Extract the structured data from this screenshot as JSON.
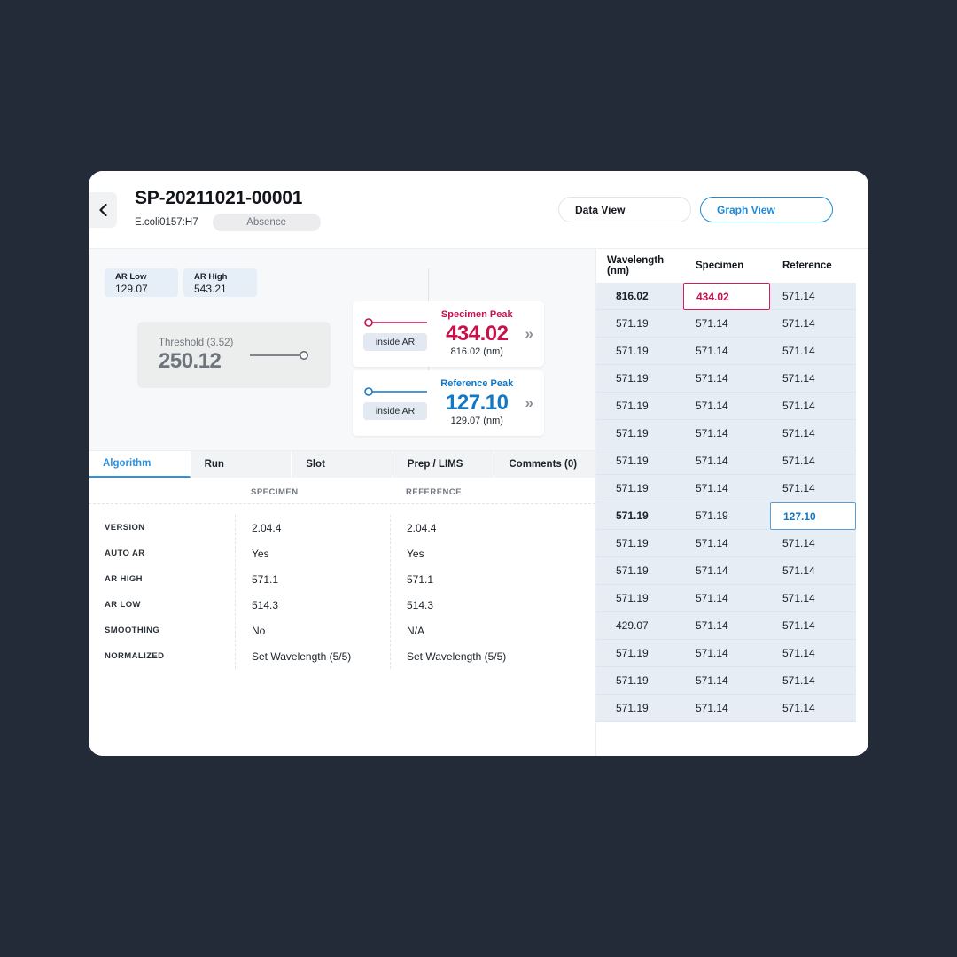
{
  "header": {
    "back_icon": "chevron-left-icon",
    "record_id": "SP-20211021-00001",
    "organism": "E.coli0157:H7",
    "status": "Absence",
    "view_buttons": [
      {
        "label": "Data View",
        "active": false
      },
      {
        "label": "Graph View",
        "active": true
      }
    ]
  },
  "summary": {
    "ar_low": {
      "label": "AR Low",
      "value": "129.07"
    },
    "ar_high": {
      "label": "AR High",
      "value": "543.21"
    },
    "threshold": {
      "label": "Threshold (3.52)",
      "value": "250.12"
    },
    "peaks": [
      {
        "name": "Specimen Peak",
        "value": "434.02",
        "wavelength": "816.02 (nm)",
        "badge": "inside AR",
        "color": "#c8104b"
      },
      {
        "name": "Reference Peak",
        "value": "127.10",
        "wavelength": "129.07 (nm)",
        "badge": "inside AR",
        "color": "#1277c4"
      }
    ]
  },
  "tabs": [
    {
      "label": "Algorithm",
      "active": true
    },
    {
      "label": "Run",
      "active": false
    },
    {
      "label": "Slot",
      "active": false
    },
    {
      "label": "Prep / LIMS",
      "active": false
    },
    {
      "label": "Comments (0)",
      "active": false
    }
  ],
  "algorithm": {
    "columns": [
      "",
      "SPECIMEN",
      "REFERENCE"
    ],
    "rows": [
      {
        "key": "VERSION",
        "specimen": "2.04.4",
        "reference": "2.04.4"
      },
      {
        "key": "AUTO AR",
        "specimen": "Yes",
        "reference": "Yes"
      },
      {
        "key": "AR HIGH",
        "specimen": "571.1",
        "reference": "571.1"
      },
      {
        "key": "AR LOW",
        "specimen": "514.3",
        "reference": "514.3"
      },
      {
        "key": "SMOOTHING",
        "specimen": "No",
        "reference": "N/A"
      },
      {
        "key": "NORMALIZED",
        "specimen": "Set Wavelength (5/5)",
        "reference": "Set Wavelength (5/5)"
      }
    ]
  },
  "data_table": {
    "columns": [
      "Wavelength (nm)",
      "Specimen",
      "Reference"
    ],
    "rows": [
      {
        "wavelength": "816.02",
        "specimen": "434.02",
        "reference": "571.14",
        "wavelength_bold": true,
        "specimen_state": "selected-red",
        "reference_state": "normal"
      },
      {
        "wavelength": "571.19",
        "specimen": "571.14",
        "reference": "571.14",
        "wavelength_bold": false,
        "specimen_state": "normal",
        "reference_state": "normal"
      },
      {
        "wavelength": "571.19",
        "specimen": "571.14",
        "reference": "571.14",
        "wavelength_bold": false,
        "specimen_state": "normal",
        "reference_state": "normal"
      },
      {
        "wavelength": "571.19",
        "specimen": "571.14",
        "reference": "571.14",
        "wavelength_bold": false,
        "specimen_state": "normal",
        "reference_state": "normal"
      },
      {
        "wavelength": "571.19",
        "specimen": "571.14",
        "reference": "571.14",
        "wavelength_bold": false,
        "specimen_state": "normal",
        "reference_state": "normal"
      },
      {
        "wavelength": "571.19",
        "specimen": "571.14",
        "reference": "571.14",
        "wavelength_bold": false,
        "specimen_state": "normal",
        "reference_state": "normal"
      },
      {
        "wavelength": "571.19",
        "specimen": "571.14",
        "reference": "571.14",
        "wavelength_bold": false,
        "specimen_state": "normal",
        "reference_state": "normal"
      },
      {
        "wavelength": "571.19",
        "specimen": "571.14",
        "reference": "571.14",
        "wavelength_bold": false,
        "specimen_state": "normal",
        "reference_state": "normal"
      },
      {
        "wavelength": "571.19",
        "specimen": "571.19",
        "reference": "127.10",
        "wavelength_bold": true,
        "specimen_state": "normal",
        "reference_state": "selected-blue"
      },
      {
        "wavelength": "571.19",
        "specimen": "571.14",
        "reference": "571.14",
        "wavelength_bold": false,
        "specimen_state": "normal",
        "reference_state": "normal"
      },
      {
        "wavelength": "571.19",
        "specimen": "571.14",
        "reference": "571.14",
        "wavelength_bold": false,
        "specimen_state": "normal",
        "reference_state": "normal"
      },
      {
        "wavelength": "571.19",
        "specimen": "571.14",
        "reference": "571.14",
        "wavelength_bold": false,
        "specimen_state": "normal",
        "reference_state": "normal"
      },
      {
        "wavelength": "429.07",
        "specimen": "571.14",
        "reference": "571.14",
        "wavelength_bold": false,
        "specimen_state": "normal",
        "reference_state": "normal"
      },
      {
        "wavelength": "571.19",
        "specimen": "571.14",
        "reference": "571.14",
        "wavelength_bold": false,
        "specimen_state": "normal",
        "reference_state": "normal"
      },
      {
        "wavelength": "571.19",
        "specimen": "571.14",
        "reference": "571.14",
        "wavelength_bold": false,
        "specimen_state": "normal",
        "reference_state": "normal"
      },
      {
        "wavelength": "571.19",
        "specimen": "571.14",
        "reference": "571.14",
        "wavelength_bold": false,
        "specimen_state": "normal",
        "reference_state": "normal"
      }
    ]
  },
  "colors": {
    "page_background": "#242b38",
    "accent_blue": "#1b8bd8",
    "specimen_crimson": "#c8104b",
    "reference_blue": "#1277c4",
    "row_background": "#e6edf5"
  }
}
